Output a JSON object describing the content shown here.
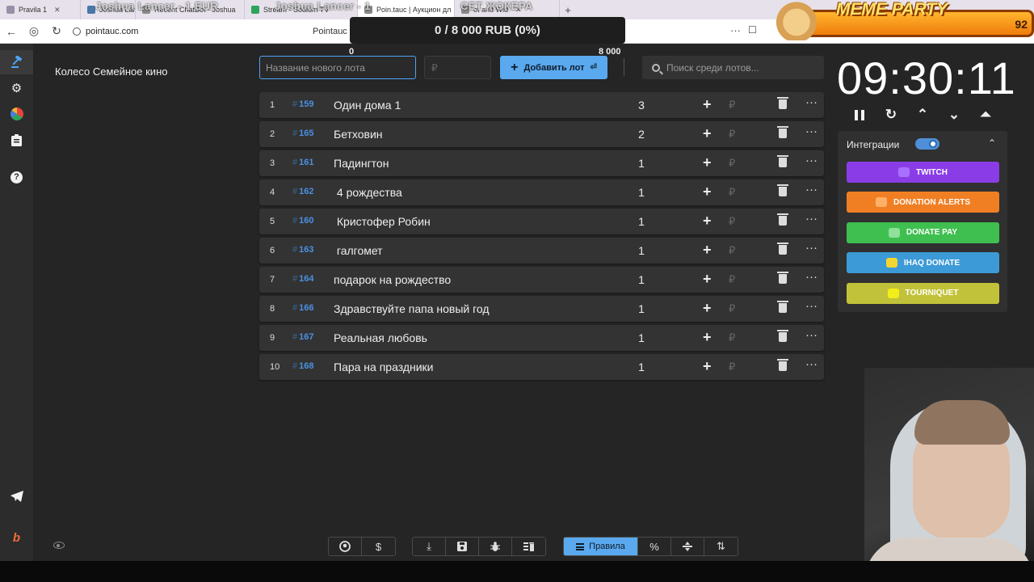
{
  "browser": {
    "tabs": [
      {
        "label": "Pravila 1",
        "color": "#9a8fa8"
      },
      {
        "label": "Joshua Lancer",
        "color": "#4a76a8"
      },
      {
        "label": "Recent ChatBot - Joshua",
        "color": "#888888"
      },
      {
        "label": "Stream - Sodium TV",
        "color": "#2ea35c"
      },
      {
        "label": "Poin.tauc | Аукцион дл",
        "color": "#888888"
      },
      {
        "label": "ot and Wid",
        "color": "#888888"
      }
    ],
    "overlay_text": [
      "Joshua Lancer - 1 EUR",
      "Joshua Lancer - 1",
      "СЕТ ЖОКЕРА"
    ],
    "url": "pointauc.com",
    "page_title": "Pointauc |"
  },
  "goal": {
    "text": "0 / 8 000 RUB (0%)",
    "min_label": "0",
    "max_label": "8 000"
  },
  "meme_party": {
    "title": "MEME PARTY",
    "value": "92"
  },
  "sidebar": {
    "wheel_name": "Колесо Семейное кино",
    "icons": [
      "gavel-icon",
      "settings-icon",
      "pie-chart-icon",
      "clipboard-icon",
      "help-icon",
      "telegram-icon",
      "boosty-icon"
    ]
  },
  "form": {
    "lot_placeholder": "Название нового лота",
    "amount_placeholder": "₽",
    "add_label": "Добавить лот",
    "search_placeholder": "Поиск среди лотов..."
  },
  "lots": [
    {
      "index": "1",
      "id": "159",
      "name": "Один дома 1",
      "amount": "3"
    },
    {
      "index": "2",
      "id": "165",
      "name": "Бетховин",
      "amount": "2"
    },
    {
      "index": "3",
      "id": "161",
      "name": "Падингтон",
      "amount": "1"
    },
    {
      "index": "4",
      "id": "162",
      "name": " 4 рождества",
      "amount": "1"
    },
    {
      "index": "5",
      "id": "160",
      "name": " Кристофер Робин",
      "amount": "1"
    },
    {
      "index": "6",
      "id": "163",
      "name": " галгомет",
      "amount": "1"
    },
    {
      "index": "7",
      "id": "164",
      "name": "подарок на рождество",
      "amount": "1"
    },
    {
      "index": "8",
      "id": "166",
      "name": "Здравствуйте папа новый год",
      "amount": "1"
    },
    {
      "index": "9",
      "id": "167",
      "name": "Реальная любовь",
      "amount": "1"
    },
    {
      "index": "10",
      "id": "168",
      "name": "Пара на праздники",
      "amount": "1"
    }
  ],
  "lot_actions": {
    "add": "+",
    "currency": "₽",
    "more": "···"
  },
  "timer": {
    "value": "09:30:11"
  },
  "integrations": {
    "label": "Интеграции",
    "enabled": true,
    "buttons": [
      {
        "label": "TWITCH",
        "color": "#8a3de6",
        "badge": "#a970ff"
      },
      {
        "label": "DONATION ALERTS",
        "color": "#f07f24",
        "badge": "#ffb066"
      },
      {
        "label": "DONATE PAY",
        "color": "#3fbf4f",
        "badge": "#8ee09a"
      },
      {
        "label": "IHAQ DONATE",
        "color": "#3c9ad6",
        "badge": "#f5d531"
      },
      {
        "label": "TOURNIQUET",
        "color": "#c2c23a",
        "badge": "#f2ee1a"
      }
    ]
  },
  "bottom_toolbar": {
    "rules_label": "Правила",
    "percent_label": "%"
  }
}
